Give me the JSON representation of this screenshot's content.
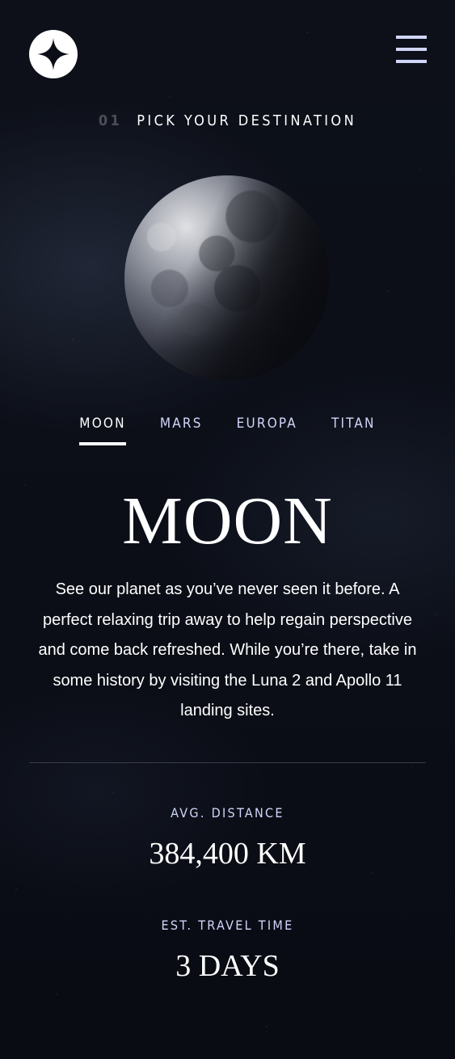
{
  "header": {
    "logo_icon": "star-logo-icon",
    "menu_icon": "hamburger-menu-icon"
  },
  "page": {
    "number": "01",
    "heading": "PICK YOUR DESTINATION"
  },
  "destination": {
    "image": "moon-image",
    "tabs": [
      {
        "label": "MOON",
        "active": true
      },
      {
        "label": "MARS",
        "active": false
      },
      {
        "label": "EUROPA",
        "active": false
      },
      {
        "label": "TITAN",
        "active": false
      }
    ],
    "name": "MOON",
    "description": "See our planet as you’ve never seen it before. A perfect relaxing trip away to help regain perspective and come back refreshed. While you’re there, take in some history by visiting the Luna 2 and Apollo 11 landing sites.",
    "distance_label": "AVG. DISTANCE",
    "distance_value": "384,400 KM",
    "travel_label": "EST. TRAVEL TIME",
    "travel_value": "3 DAYS"
  },
  "colors": {
    "background": "#0b0d17",
    "accent": "#d0d6f9",
    "text": "#ffffff"
  }
}
